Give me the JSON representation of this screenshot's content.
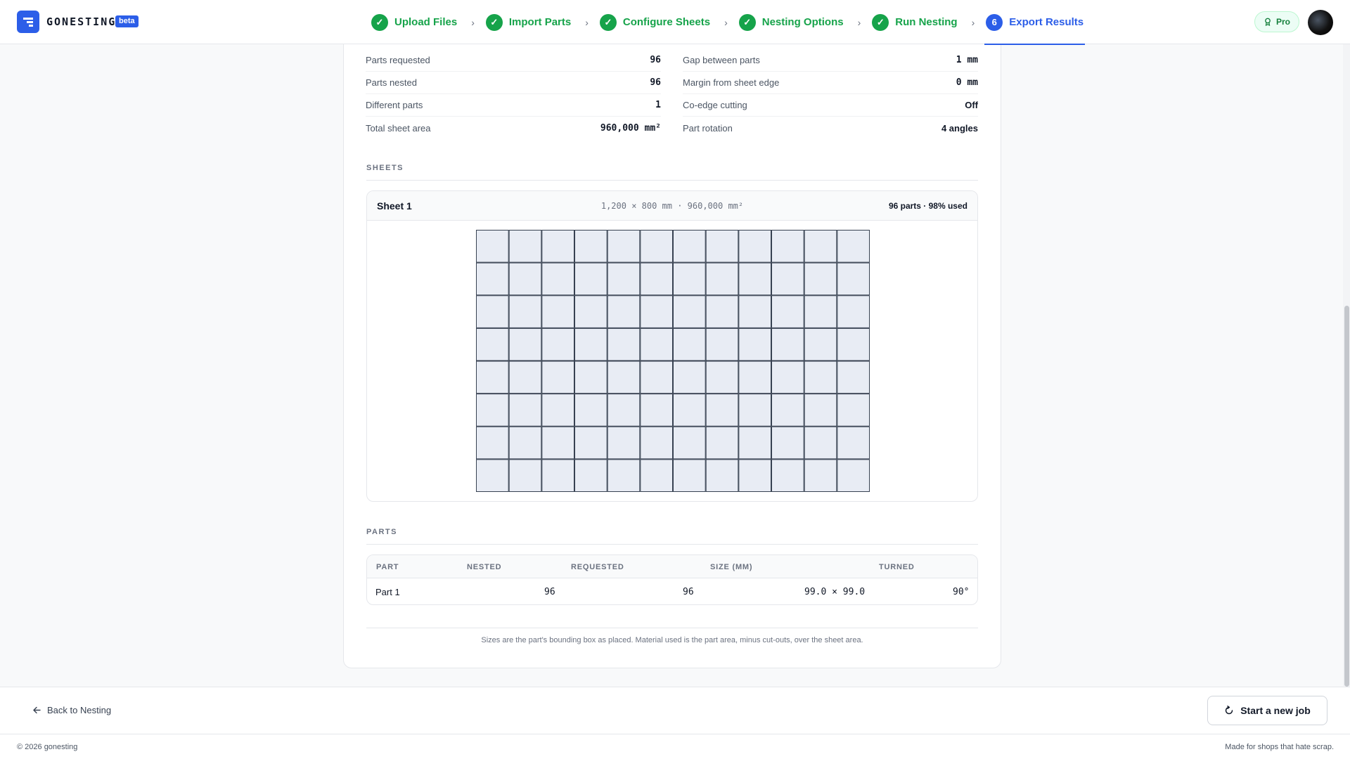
{
  "app": {
    "brand": "GONESTING",
    "badge": "beta",
    "plan": "Pro"
  },
  "steps": [
    {
      "label": "Upload Files",
      "status": "done"
    },
    {
      "label": "Import Parts",
      "status": "done"
    },
    {
      "label": "Configure Sheets",
      "status": "done"
    },
    {
      "label": "Nesting Options",
      "status": "done"
    },
    {
      "label": "Run Nesting",
      "status": "done"
    },
    {
      "label": "Export Results",
      "status": "current",
      "number": "6"
    }
  ],
  "summary": {
    "left": [
      {
        "label": "Parts requested",
        "value": "96"
      },
      {
        "label": "Parts nested",
        "value": "96"
      },
      {
        "label": "Different parts",
        "value": "1"
      },
      {
        "label": "Total sheet area",
        "value": "960,000 mm²"
      }
    ],
    "right": [
      {
        "label": "Gap between parts",
        "value": "1 mm"
      },
      {
        "label": "Margin from sheet edge",
        "value": "0 mm"
      },
      {
        "label": "Co-edge cutting",
        "value": "Off"
      },
      {
        "label": "Part rotation",
        "value": "4 angles"
      }
    ]
  },
  "sheets": {
    "title": "SHEETS",
    "items": [
      {
        "name": "Sheet 1",
        "dims": "1,200 × 800 mm · 960,000 mm²",
        "usage": "96 parts · 98% used",
        "grid": {
          "cols": 12,
          "rows": 8,
          "sheet_w_mm": 1200,
          "sheet_h_mm": 800,
          "part_w_mm": 99.0,
          "part_h_mm": 99.0,
          "gap_mm": 1
        }
      }
    ]
  },
  "parts": {
    "title": "PARTS",
    "columns": [
      "PART",
      "NESTED",
      "REQUESTED",
      "SIZE (MM)",
      "TURNED"
    ],
    "rows": [
      {
        "part": "Part 1",
        "nested": "96",
        "requested": "96",
        "size": "99.0 × 99.0",
        "turned": "90°"
      }
    ]
  },
  "footnote": "Sizes are the part's bounding box as placed. Material used is the part area, minus cut-outs, over the sheet area.",
  "actions": {
    "back": "Back to Nesting",
    "new_job": "Start a new job"
  },
  "footer": {
    "copyright": "© 2026 gonesting",
    "tagline": "Made for shops that hate scrap."
  },
  "colors": {
    "accent": "#2c5ee8",
    "success": "#16a34a",
    "part_fill": "#e8ecf4",
    "part_stroke": "#374151"
  }
}
